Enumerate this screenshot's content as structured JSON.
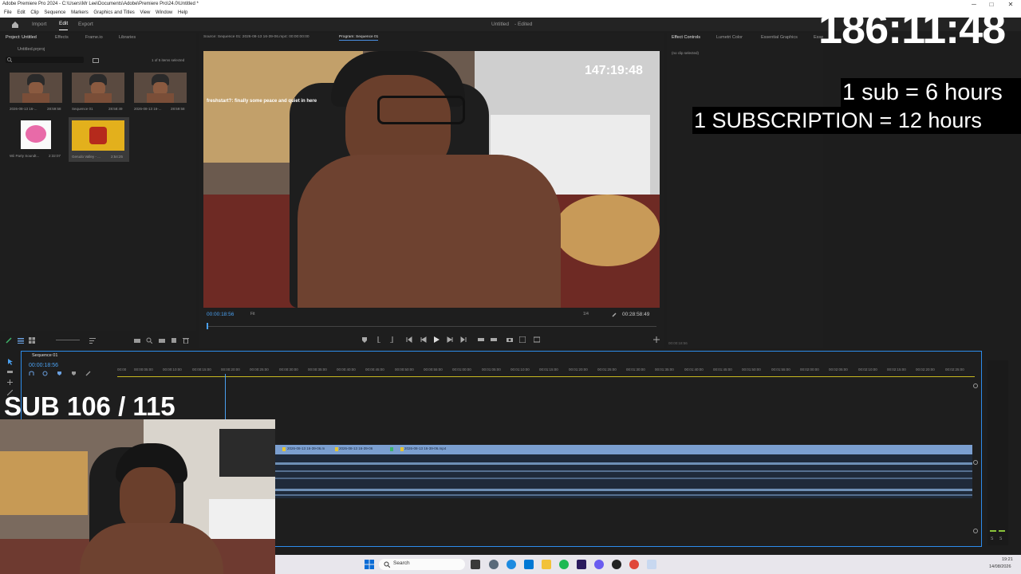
{
  "window": {
    "title": "Adobe Premiere Pro 2024 - C:\\Users\\Mr Lee\\Documents\\Adobe\\Premiere Pro\\24.0\\Untitled *",
    "min": "─",
    "max": "□",
    "close": "✕"
  },
  "menu": [
    "File",
    "Edit",
    "Clip",
    "Sequence",
    "Markers",
    "Graphics and Titles",
    "View",
    "Window",
    "Help"
  ],
  "workspace": {
    "tabs": [
      "Import",
      "Edit",
      "Export"
    ],
    "doc_title": "Untitled",
    "doc_status": "- Edited"
  },
  "project_panel": {
    "tabs": [
      "Project: Untitled",
      "Effects",
      "Frame.io",
      "Libraries"
    ],
    "file": "Untitled.prproj",
    "selection_count": "1 of 5 items selected",
    "items": [
      {
        "label": "2026-08-13 16-...",
        "duration": "28:59:58"
      },
      {
        "label": "Sequence 01",
        "duration": "28:58:49"
      },
      {
        "label": "2026-08-13 16-...",
        "duration": "28:59:58"
      },
      {
        "label": "Wii Party Soundt...",
        "duration": "2:32:07"
      },
      {
        "label": "Gerudo Valley - ...",
        "duration": "2:54:25"
      }
    ]
  },
  "monitor": {
    "source_tab": "Source: Sequence 01: 2026-08-13 16-39-06.mp4: 00:00:00:00",
    "program_tab": "Program: Sequence 01",
    "timer": "147:19:48",
    "chat": "freshstart?: finally some peace and quiet in here",
    "timecode": "00:00:18:56",
    "fit": "Fit",
    "resolution": "1/4",
    "duration": "00:28:58:49"
  },
  "effects_panel": {
    "tabs": [
      "Effect Controls",
      "Lumetri Color",
      "Essential Graphics",
      "Esse"
    ],
    "no_clip": "(no clip selected)",
    "bottom_tc": "00:00:18:56"
  },
  "timeline": {
    "tab": "Sequence 01",
    "timecode": "00:00:18:56",
    "ruler": [
      "00:00",
      "00:00:05:00",
      "00:00:10:00",
      "00:00:15:00",
      "00:00:20:00",
      "00:00:25:00",
      "00:00:30:00",
      "00:00:35:00",
      "00:00:40:00",
      "00:00:45:00",
      "00:00:50:00",
      "00:00:55:00",
      "00:01:00:00",
      "00:01:05:00",
      "00:01:10:00",
      "00:01:15:00",
      "00:01:20:00",
      "00:01:25:00",
      "00:01:30:00",
      "00:01:35:00",
      "00:01:40:00",
      "00:01:45:00",
      "00:01:50:00",
      "00:01:55:00",
      "00:02:00:00",
      "00:02:05:00",
      "00:02:10:00",
      "00:02:15:00",
      "00:02:20:00",
      "00:02:25:00"
    ],
    "clips": [
      "2026-08-13 16-39-06.m",
      "2026-08-13 16-39-06",
      "2026-08-13 16-39-06.mp4"
    ]
  },
  "overlays": {
    "big_timer": "186:11:48",
    "sub_rate": "1 sub = 6 hours",
    "subscription_rate": "1 SUBSCRIPTION = 12 hours",
    "sub_count": "SUB 106 / 115"
  },
  "meter_labels": [
    "S",
    "S"
  ],
  "taskbar": {
    "search": "Search",
    "time": "19:21",
    "date": "14/08/2026"
  },
  "colors": {
    "accent": "#2d8ceb",
    "clip": "#7b9fd0",
    "program_tab": "#4a90e2"
  }
}
